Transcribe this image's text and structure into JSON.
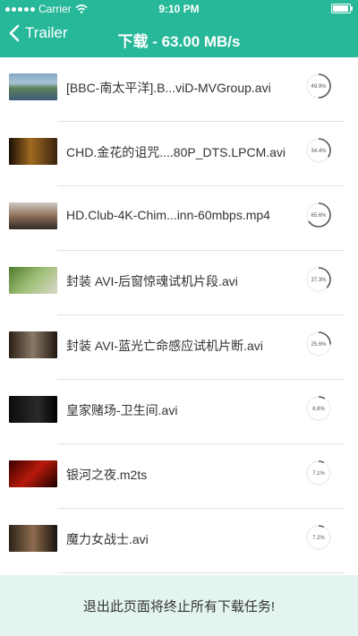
{
  "status_bar": {
    "carrier": "Carrier",
    "time": "9:10 PM",
    "battery_fraction": 0.95
  },
  "nav": {
    "back_label": "Trailer",
    "title": "下载 - 63.00 MB/s"
  },
  "downloads": [
    {
      "name": "[BBC-南太平洋].B...viD-MVGroup.avi",
      "progress_text": "49.9%",
      "progress": 0.499
    },
    {
      "name": "CHD.金花的诅咒....80P_DTS.LPCM.avi",
      "progress_text": "34.4%",
      "progress": 0.344
    },
    {
      "name": "HD.Club-4K-Chim...inn-60mbps.mp4",
      "progress_text": "65.6%",
      "progress": 0.656
    },
    {
      "name": "封装 AVI-后窗惊魂试机片段.avi",
      "progress_text": "37.3%",
      "progress": 0.373
    },
    {
      "name": "封装 AVI-蓝光亡命感应试机片断.avi",
      "progress_text": "25.6%",
      "progress": 0.256
    },
    {
      "name": "皇家赌场-卫生间.avi",
      "progress_text": "8.8%",
      "progress": 0.088
    },
    {
      "name": "银河之夜.m2ts",
      "progress_text": "7.1%",
      "progress": 0.071
    },
    {
      "name": "魔力女战士.avi",
      "progress_text": "7.2%",
      "progress": 0.072
    }
  ],
  "footer": {
    "message": "退出此页面将终止所有下载任务!"
  },
  "colors": {
    "accent": "#27b89a",
    "footer_bg": "#e4f5f1",
    "ring_track": "#e6e6e6",
    "ring_fill": "#555555"
  }
}
